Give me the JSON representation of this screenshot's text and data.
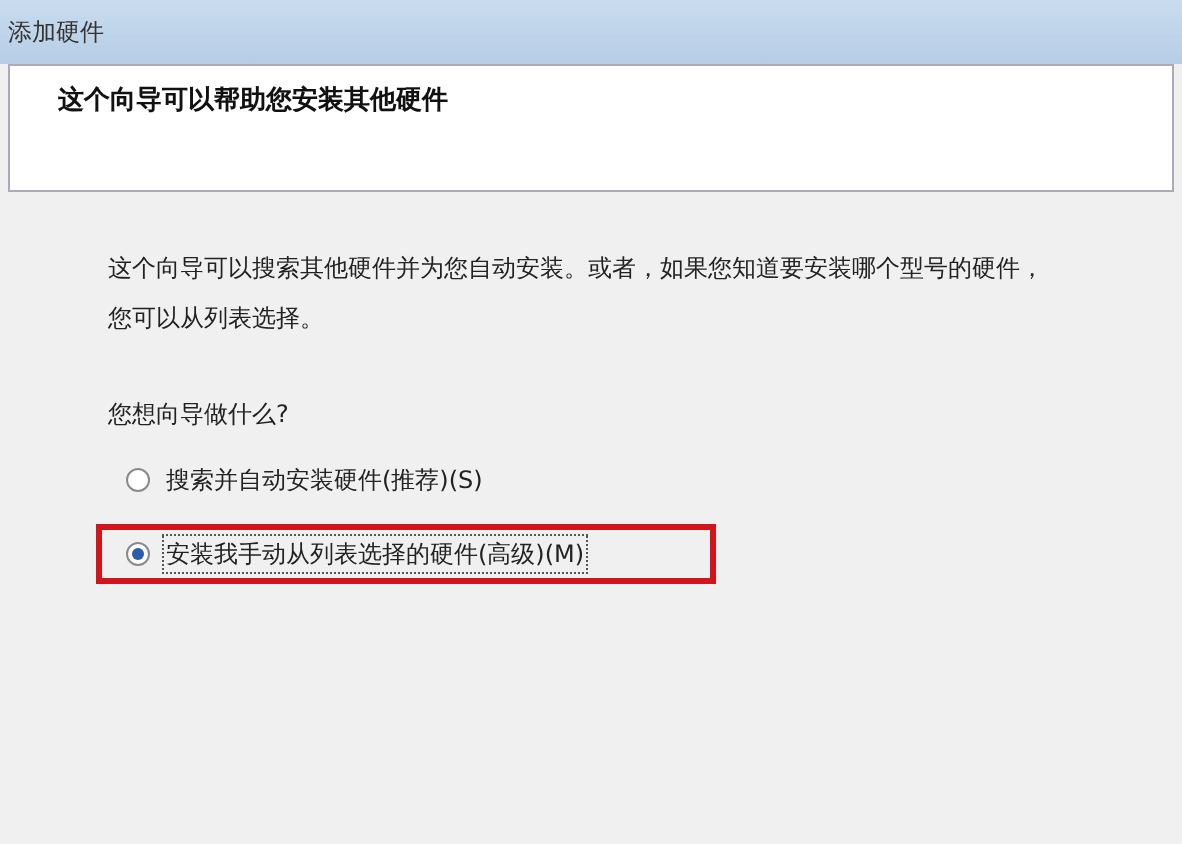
{
  "window": {
    "title": "添加硬件"
  },
  "header": {
    "title": "这个向导可以帮助您安装其他硬件"
  },
  "body": {
    "description": "这个向导可以搜索其他硬件并为您自动安装。或者，如果您知道要安装哪个型号的硬件，您可以从列表选择。",
    "question": "您想向导做什么?",
    "options": [
      {
        "label": "搜索并自动安装硬件(推荐)(S)",
        "selected": false,
        "highlighted": false
      },
      {
        "label": "安装我手动从列表选择的硬件(高级)(M)",
        "selected": true,
        "highlighted": true
      }
    ]
  }
}
